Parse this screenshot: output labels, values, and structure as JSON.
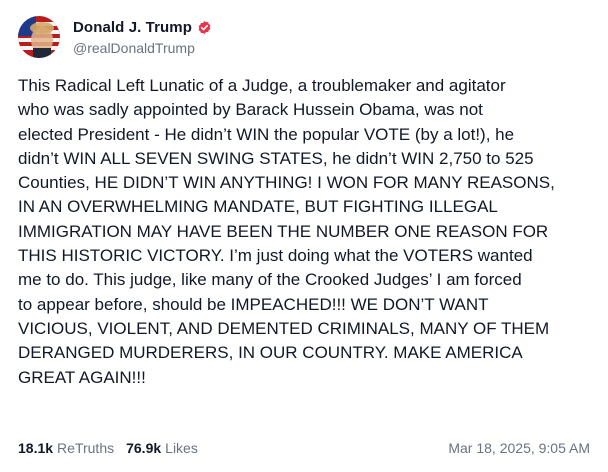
{
  "author": {
    "display_name": "Donald J. Trump",
    "handle": "@realDonaldTrump",
    "verified_icon": "verified-badge-icon",
    "verified_color": "#e8344e"
  },
  "post": {
    "text": "This Radical Left Lunatic of a Judge, a troublemaker and agitator\nwho was sadly appointed by Barack Hussein Obama, was not\nelected President - He didn’t WIN the popular VOTE (by a lot!), he\ndidn’t WIN ALL SEVEN SWING STATES, he didn’t WIN 2,750 to 525\nCounties, HE DIDN’T WIN ANYTHING! I WON FOR MANY REASONS,\nIN AN OVERWHELMING MANDATE, BUT FIGHTING ILLEGAL\nIMMIGRATION MAY HAVE BEEN THE NUMBER ONE REASON FOR\nTHIS HISTORIC VICTORY. I’m just doing what the VOTERS wanted\nme to do. This judge, like many of the Crooked Judges’ I am forced\nto appear before, should be IMPEACHED!!! WE DON’T WANT\nVICIOUS, VIOLENT, AND DEMENTED CRIMINALS, MANY OF THEM\nDERANGED MURDERERS, IN OUR COUNTRY. MAKE AMERICA\nGREAT AGAIN!!!"
  },
  "stats": {
    "retruths_count": "18.1k",
    "retruths_label": "ReTruths",
    "likes_count": "76.9k",
    "likes_label": "Likes"
  },
  "timestamp": "Mar 18, 2025, 9:05 AM"
}
